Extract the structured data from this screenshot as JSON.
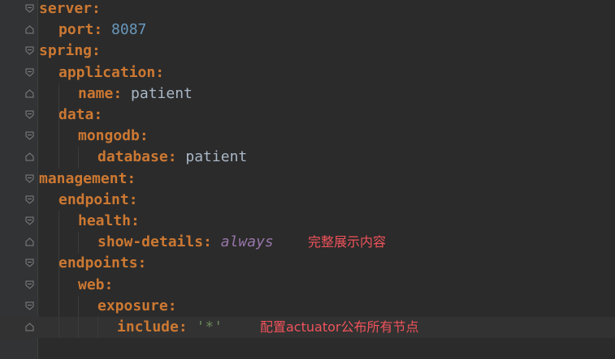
{
  "lines": [
    {
      "indent": 0,
      "key": "server:",
      "value": "",
      "fold": "open"
    },
    {
      "indent": 1,
      "key": "port:",
      "value": "8087",
      "value_kind": "num",
      "fold": "end"
    },
    {
      "indent": 0,
      "key": "spring:",
      "value": "",
      "fold": "open"
    },
    {
      "indent": 1,
      "key": "application:",
      "value": "",
      "fold": "open"
    },
    {
      "indent": 2,
      "key": "name:",
      "value": "patient",
      "value_kind": "str",
      "fold": "end"
    },
    {
      "indent": 1,
      "key": "data:",
      "value": "",
      "fold": "open"
    },
    {
      "indent": 2,
      "key": "mongodb:",
      "value": "",
      "fold": "open"
    },
    {
      "indent": 3,
      "key": "database:",
      "value": "patient",
      "value_kind": "str",
      "fold": "end"
    },
    {
      "indent": 0,
      "key": "management:",
      "value": "",
      "fold": "open"
    },
    {
      "indent": 1,
      "key": "endpoint:",
      "value": "",
      "fold": "open"
    },
    {
      "indent": 2,
      "key": "health:",
      "value": "",
      "fold": "open"
    },
    {
      "indent": 3,
      "key": "show-details:",
      "value": "always",
      "value_kind": "ital",
      "fold": "end"
    },
    {
      "indent": 1,
      "key": "endpoints:",
      "value": "",
      "fold": "open"
    },
    {
      "indent": 2,
      "key": "web:",
      "value": "",
      "fold": "open"
    },
    {
      "indent": 3,
      "key": "exposure:",
      "value": "",
      "fold": "open"
    },
    {
      "indent": 4,
      "key": "include:",
      "value": "'*'",
      "value_kind": "quote",
      "fold": "end",
      "active": true
    }
  ],
  "annotations": {
    "show_details_note": "完整展示内容",
    "include_note": "配置actuator公布所有节点"
  },
  "colors": {
    "background": "#2b2b2b",
    "key": "#cc7832",
    "number": "#6897bb",
    "annotation": "#f0535b"
  }
}
